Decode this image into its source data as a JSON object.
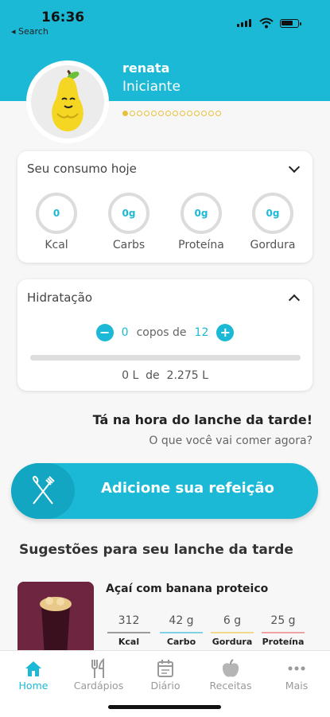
{
  "status_bar": {
    "time": "16:36",
    "back_label": "◂ Search"
  },
  "profile": {
    "name": "renata",
    "level": "Iniciante",
    "progress_total": 14,
    "progress_done": 1
  },
  "consumption": {
    "title": "Seu consumo hoje",
    "items": [
      {
        "value": "0",
        "label": "Kcal"
      },
      {
        "value": "0g",
        "label": "Carbs"
      },
      {
        "value": "0g",
        "label": "Proteína"
      },
      {
        "value": "0g",
        "label": "Gordura"
      }
    ]
  },
  "hydration": {
    "title": "Hidratação",
    "cups": "0",
    "cups_of": "copos de",
    "cups_total": "12",
    "liters": "0 L  de  2.275 L",
    "progress": 0
  },
  "prompt": {
    "question": "Tá na hora do lanche da tarde!",
    "subtitle": "O que você vai comer agora?"
  },
  "add_meal": {
    "label": "Adicione sua refeição"
  },
  "suggestions": {
    "title": "Sugestões para seu lanche da tarde",
    "food": {
      "name": "Açaí com banana proteico",
      "macros": [
        {
          "value": "312",
          "label": "Kcal",
          "color": "#9b9b9b"
        },
        {
          "value": "42 g",
          "label": "Carbo",
          "color": "#7fd1e3"
        },
        {
          "value": "6 g",
          "label": "Gordura",
          "color": "#f2d98a"
        },
        {
          "value": "25 g",
          "label": "Proteína",
          "color": "#f0a3a3"
        }
      ]
    }
  },
  "tabs": [
    {
      "label": "Home",
      "icon": "home-icon",
      "active": true
    },
    {
      "label": "Cardápios",
      "icon": "cutlery-icon",
      "active": false
    },
    {
      "label": "Diário",
      "icon": "calendar-icon",
      "active": false
    },
    {
      "label": "Receitas",
      "icon": "apple-icon",
      "active": false
    },
    {
      "label": "Mais",
      "icon": "more-icon",
      "active": false
    }
  ],
  "colors": {
    "accent": "#1cb9d6",
    "accent_dark": "#12a6c3",
    "progress_dot": "#e8c13c"
  }
}
